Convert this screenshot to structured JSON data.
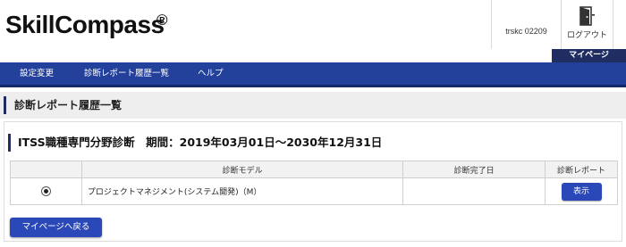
{
  "header": {
    "logo_text": "SkillCompass",
    "logo_mark": "®",
    "user_id": "trskc 02209",
    "logout_label": "ログアウト",
    "logout_icon": "door-exit-icon"
  },
  "mypage_tab": {
    "label": "マイページ"
  },
  "nav": {
    "items": [
      {
        "label": "設定変更"
      },
      {
        "label": "診断レポート履歴一覧"
      },
      {
        "label": "ヘルプ"
      }
    ]
  },
  "page": {
    "title": "診断レポート履歴一覧",
    "section_title": "ITSS職種専門分野診断　期間：2019年03月01日～2030年12月31日"
  },
  "table": {
    "headers": [
      "",
      "診断モデル",
      "診断完了日",
      "診断レポート"
    ],
    "rows": [
      {
        "selected": true,
        "model": "プロジェクトマネジメント(システム開発)（M）",
        "completed_date": "",
        "action_label": "表示"
      }
    ]
  },
  "back_button": {
    "label": "マイページへ戻る"
  },
  "colors": {
    "nav_bg": "#23409a",
    "nav_border": "#15286a",
    "mypage_bg": "#1f2d63",
    "button_bg": "#2a48b8",
    "title_band_bg": "#eeeeee",
    "table_header_bg": "#f2f2f2"
  }
}
